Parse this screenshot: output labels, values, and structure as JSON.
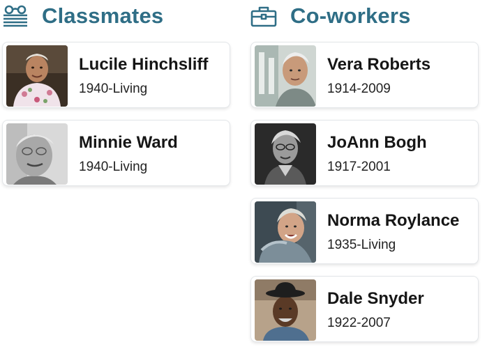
{
  "classmates": {
    "title": "Classmates",
    "icon": "glasses-book-icon",
    "people": [
      {
        "name": "Lucile Hinchsliff",
        "dates": "1940-Living"
      },
      {
        "name": "Minnie Ward",
        "dates": "1940-Living"
      }
    ]
  },
  "coworkers": {
    "title": "Co-workers",
    "icon": "briefcase-icon",
    "people": [
      {
        "name": "Vera Roberts",
        "dates": "1914-2009"
      },
      {
        "name": "JoAnn Bogh",
        "dates": "1917-2001"
      },
      {
        "name": "Norma Roylance",
        "dates": "1935-Living"
      },
      {
        "name": "Dale Snyder",
        "dates": "1922-2007"
      }
    ]
  },
  "colors": {
    "heading": "#2f6e86",
    "icon": "#2f6e86"
  }
}
